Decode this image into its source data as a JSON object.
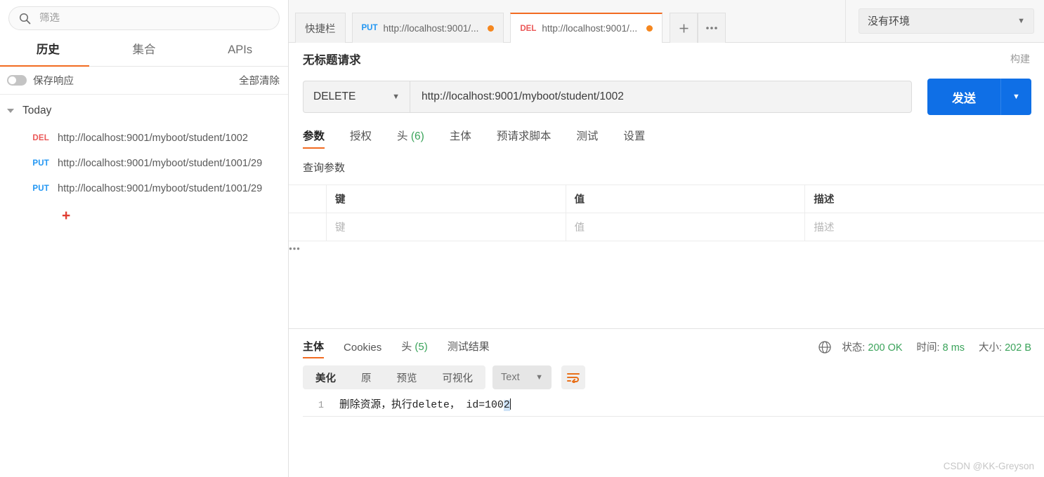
{
  "sidebar": {
    "search": {
      "placeholder": "筛选",
      "value": "",
      "icon": "search-icon"
    },
    "tabs": [
      {
        "label": "历史",
        "active": true
      },
      {
        "label": "集合",
        "active": false
      },
      {
        "label": "APIs",
        "active": false
      }
    ],
    "controls": {
      "save_responses_label": "保存响应",
      "save_responses_on": false,
      "clear_all_label": "全部清除"
    },
    "group": {
      "title": "Today",
      "expanded": true
    },
    "history": [
      {
        "method": "DEL",
        "url": "http://localhost:9001/myboot/student/1002"
      },
      {
        "method": "PUT",
        "url": "http://localhost:9001/myboot/student/1001/29"
      },
      {
        "method": "PUT",
        "url": "http://localhost:9001/myboot/student/1001/29"
      }
    ],
    "add_label": "+"
  },
  "tabstrip": {
    "tabs": [
      {
        "label": "快捷栏",
        "method": "",
        "url": "",
        "active": false,
        "dirty": false
      },
      {
        "label": "",
        "method": "PUT",
        "url": "http://localhost:9001/...",
        "active": false,
        "dirty": true
      },
      {
        "label": "",
        "method": "DEL",
        "url": "http://localhost:9001/...",
        "active": true,
        "dirty": true
      }
    ],
    "new_tab_label": "+",
    "more_label": "•••",
    "environment": {
      "value": "没有环境"
    }
  },
  "request": {
    "title": "无标题请求",
    "build_label": "构建",
    "method": "DELETE",
    "url": "http://localhost:9001/myboot/student/1002",
    "send_label": "发送",
    "tabs": [
      {
        "label": "参数",
        "count": "",
        "active": true
      },
      {
        "label": "授权",
        "count": "",
        "active": false
      },
      {
        "label": "头",
        "count": "(6)",
        "active": false
      },
      {
        "label": "主体",
        "count": "",
        "active": false
      },
      {
        "label": "预请求脚本",
        "count": "",
        "active": false
      },
      {
        "label": "测试",
        "count": "",
        "active": false
      },
      {
        "label": "设置",
        "count": "",
        "active": false
      }
    ],
    "query_params_label": "查询参数",
    "param_table": {
      "headers": [
        "键",
        "值",
        "描述"
      ],
      "placeholders": [
        "键",
        "值",
        "描述"
      ],
      "rows": []
    }
  },
  "response": {
    "tabs": [
      {
        "label": "主体",
        "count": "",
        "active": true
      },
      {
        "label": "Cookies",
        "count": "",
        "active": false
      },
      {
        "label": "头",
        "count": "(5)",
        "active": false
      },
      {
        "label": "测试结果",
        "count": "",
        "active": false
      }
    ],
    "meta": {
      "status_label": "状态:",
      "status_value": "200 OK",
      "time_label": "时间:",
      "time_value": "8 ms",
      "size_label": "大小:",
      "size_value": "202 B"
    },
    "format_bar": {
      "segments": [
        {
          "label": "美化",
          "active": true
        },
        {
          "label": "原",
          "active": false
        },
        {
          "label": "预览",
          "active": false
        },
        {
          "label": "可视化",
          "active": false
        }
      ],
      "type": "Text",
      "wrap_icon": "wrap-text-icon"
    },
    "body": {
      "line_number": "1",
      "text_plain": "删除资源，执行delete， id=100",
      "text_selected": "2"
    }
  },
  "watermark": "CSDN @KK-Greyson",
  "colors": {
    "accent": "#f26b21",
    "send_blue": "#0f6fe6",
    "status_green": "#3aa35a",
    "delete_red": "#eb5757",
    "put_blue": "#2196f3"
  }
}
